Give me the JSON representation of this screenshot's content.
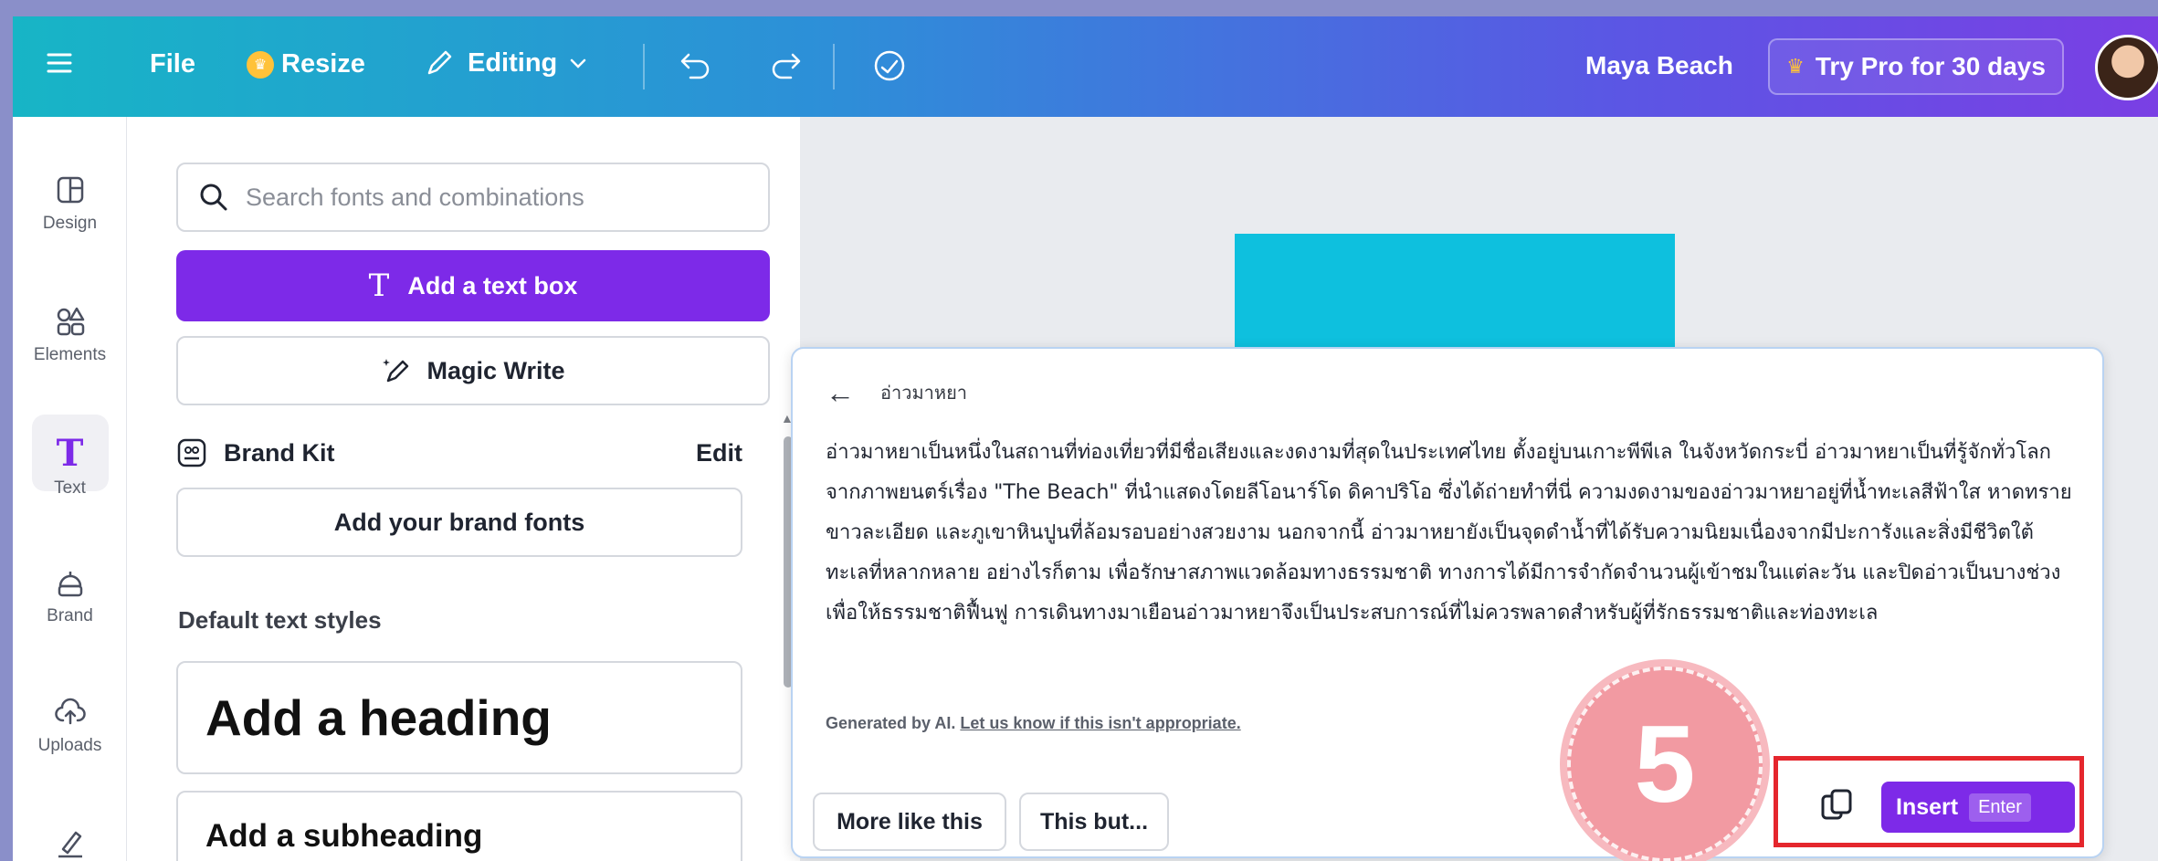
{
  "topbar": {
    "file": "File",
    "resize": "Resize",
    "editing": "Editing",
    "project_name": "Maya Beach",
    "try_pro": "Try Pro for 30 days"
  },
  "rail": {
    "items": [
      {
        "label": "Design",
        "icon": "layout-icon"
      },
      {
        "label": "Elements",
        "icon": "shapes-icon"
      },
      {
        "label": "Text",
        "icon": "text-icon"
      },
      {
        "label": "Brand",
        "icon": "brand-icon"
      },
      {
        "label": "Uploads",
        "icon": "upload-cloud-icon"
      },
      {
        "label": "",
        "icon": "draw-icon"
      }
    ]
  },
  "panel": {
    "search_placeholder": "Search fonts and combinations",
    "add_text_box": "Add a text box",
    "magic_write": "Magic Write",
    "brand_kit": "Brand Kit",
    "brand_edit": "Edit",
    "add_brand_fonts": "Add your brand fonts",
    "default_styles_label": "Default text styles",
    "heading": "Add a heading",
    "subheading": "Add a subheading"
  },
  "popup": {
    "title": "อ่าวมาหยา",
    "body": "อ่าวมาหยาเป็นหนึ่งในสถานที่ท่องเที่ยวที่มีชื่อเสียงและงดงามที่สุดในประเทศไทย ตั้งอยู่บนเกาะพีพีเล ในจังหวัดกระบี่ อ่าวมาหยาเป็นที่รู้จักทั่วโลกจากภาพยนตร์เรื่อง \"The Beach\" ที่นำแสดงโดยลีโอนาร์โด ดิคาปริโอ ซึ่งได้ถ่ายทำที่นี่ ความงดงามของอ่าวมาหยาอยู่ที่น้ำทะเลสีฟ้าใส หาดทรายขาวละเอียด และภูเขาหินปูนที่ล้อมรอบอย่างสวยงาม นอกจากนี้ อ่าวมาหยายังเป็นจุดดำน้ำที่ได้รับความนิยมเนื่องจากมีปะการังและสิ่งมีชีวิตใต้ทะเลที่หลากหลาย อย่างไรก็ตาม เพื่อรักษาสภาพแวดล้อมทางธรรมชาติ ทางการได้มีการจำกัดจำนวนผู้เข้าชมในแต่ละวัน และปิดอ่าวเป็นบางช่วงเพื่อให้ธรรมชาติฟื้นฟู การเดินทางมาเยือนอ่าวมาหยาจึงเป็นประสบการณ์ที่ไม่ควรพลาดสำหรับผู้ที่รักธรรมชาติและท่องทะเล",
    "generated_by": "Generated by AI.",
    "feedback_link": "Let us know if this isn't appropriate.",
    "more_like_this": "More like this",
    "this_but": "This but...",
    "insert": "Insert",
    "insert_shortcut": "Enter"
  },
  "step_badge": "5",
  "colors": {
    "accent_purple": "#7d2ae8",
    "canvas_block": "#0ec0de",
    "highlight_red": "#e5262d",
    "badge_pink": "#f29aa2"
  }
}
